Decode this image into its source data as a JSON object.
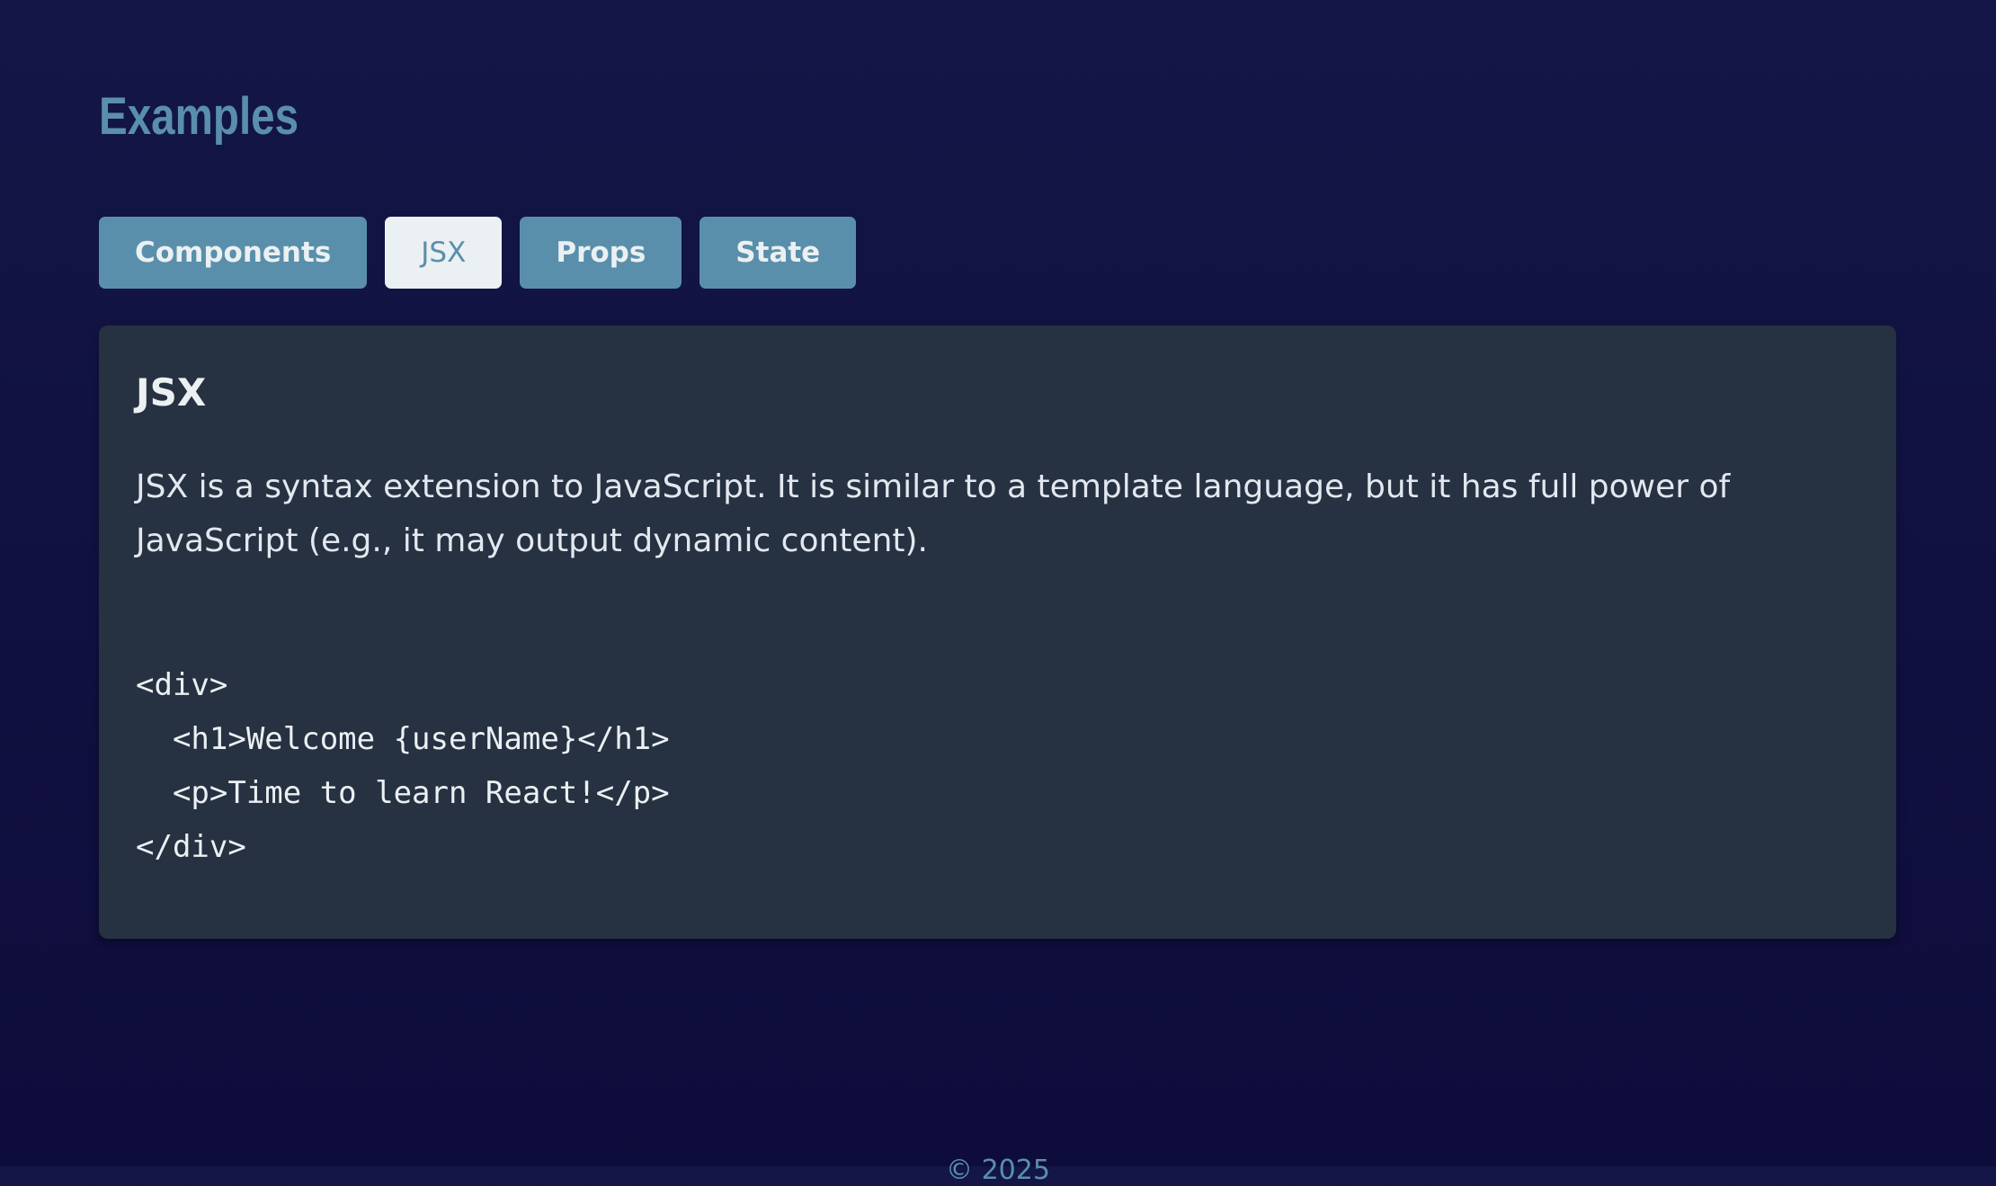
{
  "section_title": "Examples",
  "tabs": [
    {
      "label": "Components",
      "active": false
    },
    {
      "label": "JSX",
      "active": true
    },
    {
      "label": "Props",
      "active": false
    },
    {
      "label": "State",
      "active": false
    }
  ],
  "content": {
    "title": "JSX",
    "description": "JSX is a syntax extension to JavaScript. It is similar to a template language, but it has full power of JavaScript (e.g., it may output dynamic content).",
    "code": "<div>\n  <h1>Welcome {userName}</h1>\n  <p>Time to learn React!</p>\n</div>"
  },
  "footer": "© 2025",
  "colors": {
    "accent": "#5a8fab",
    "panel": "#263142",
    "background": "#111344"
  }
}
